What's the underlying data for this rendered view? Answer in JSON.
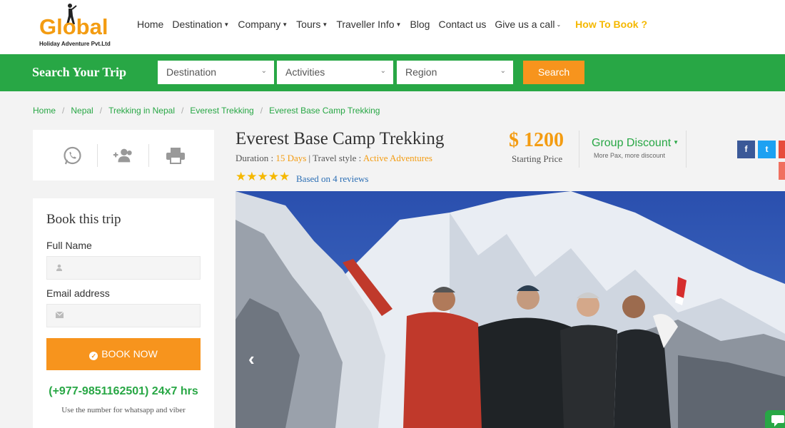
{
  "logo": {
    "word": "Global",
    "tagline": "Holiday Adventure Pvt.Ltd"
  },
  "nav": [
    {
      "label": "Home",
      "dropdown": false
    },
    {
      "label": "Destination",
      "dropdown": true
    },
    {
      "label": "Company",
      "dropdown": true
    },
    {
      "label": "Tours",
      "dropdown": true
    },
    {
      "label": "Traveller Info",
      "dropdown": true
    },
    {
      "label": "Blog",
      "dropdown": false
    },
    {
      "label": "Contact us",
      "dropdown": false
    },
    {
      "label": "Give us a call",
      "dropdown": true
    }
  ],
  "nav_accent": "How To Book ?",
  "search": {
    "title": "Search Your Trip",
    "destination": "Destination",
    "activities": "Activities",
    "region": "Region",
    "button": "Search"
  },
  "breadcrumb": [
    "Home",
    "Nepal",
    "Trekking in Nepal",
    "Everest Trekking",
    "Everest Base Camp Trekking"
  ],
  "share_icons": [
    "whatsapp-icon",
    "add-users-icon",
    "print-icon"
  ],
  "booking": {
    "title": "Book this trip",
    "full_name_label": "Full Name",
    "email_label": "Email address",
    "button": "BOOK NOW",
    "phone": "(+977-9851162501) 24x7 hrs",
    "phone_note": "Use the number for whatsapp and viber"
  },
  "trip": {
    "title": "Everest Base Camp Trekking",
    "duration_label": "Duration : ",
    "duration": "15 Days",
    "style_label": " | Travel style : ",
    "style": "Active Adventures",
    "rating_stars": "★★★★★",
    "rating": 5,
    "reviews": "Based on 4 reviews",
    "price": "$ 1200",
    "price_label": "Starting Price",
    "group_discount": "Group Discount",
    "group_discount_sub": "More Pax, more discount"
  },
  "social": [
    {
      "name": "facebook",
      "glyph": "f",
      "color": "#3b5998"
    },
    {
      "name": "twitter",
      "glyph": "t",
      "color": "#1da1f2"
    }
  ],
  "colors": {
    "green": "#28a745",
    "orange": "#f7941d",
    "accent_yellow": "#f5b800"
  }
}
